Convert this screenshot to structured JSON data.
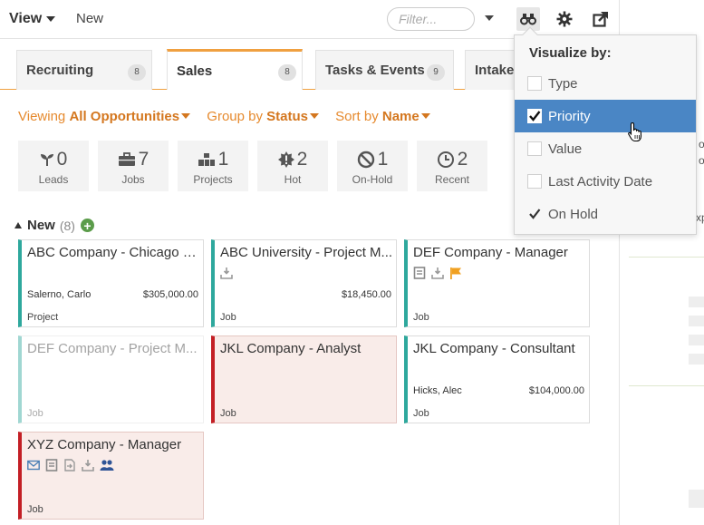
{
  "toolbar": {
    "view_label": "View",
    "new_label": "New",
    "filter_placeholder": "Filter..."
  },
  "tabs": [
    {
      "label": "Recruiting",
      "count": "8",
      "active": false
    },
    {
      "label": "Sales",
      "count": "8",
      "active": true
    },
    {
      "label": "Tasks & Events",
      "count": "9",
      "active": false
    },
    {
      "label": "Intake",
      "count": "",
      "active": false
    }
  ],
  "view_options": {
    "viewing_label": "Viewing",
    "viewing_value": "All Opportunities",
    "group_label": "Group by",
    "group_value": "Status",
    "sort_label": "Sort by",
    "sort_value": "Name"
  },
  "stats": [
    {
      "icon": "sprout-icon",
      "value": "0",
      "label": "Leads"
    },
    {
      "icon": "briefcase-icon",
      "value": "7",
      "label": "Jobs"
    },
    {
      "icon": "stacked-boxes-icon",
      "value": "1",
      "label": "Projects"
    },
    {
      "icon": "hot-badge-icon",
      "value": "2",
      "label": "Hot"
    },
    {
      "icon": "prohibited-icon",
      "value": "1",
      "label": "On-Hold"
    },
    {
      "icon": "clock-icon",
      "value": "2",
      "label": "Recent"
    }
  ],
  "section": {
    "title": "New",
    "count": "(8)"
  },
  "cards": [
    {
      "title": "ABC Company - Chicago E...",
      "person": "Salerno, Carlo",
      "amount": "$305,000.00",
      "type": "Project",
      "icons": [],
      "priority": false,
      "faded": false
    },
    {
      "title": "ABC University - Project M...",
      "person": "",
      "amount": "$18,450.00",
      "type": "Job",
      "icons": [
        "inbox-icon"
      ],
      "priority": false,
      "faded": false
    },
    {
      "title": "DEF Company - Manager",
      "person": "",
      "amount": "",
      "type": "Job",
      "icons": [
        "note-icon",
        "inbox-icon",
        "flag-icon"
      ],
      "priority": false,
      "faded": false
    },
    {
      "title": "DEF Company - Project M...",
      "person": "",
      "amount": "",
      "type": "Job",
      "icons": [],
      "priority": false,
      "faded": true
    },
    {
      "title": "JKL Company - Analyst",
      "person": "",
      "amount": "",
      "type": "Job",
      "icons": [],
      "priority": true,
      "faded": false
    },
    {
      "title": "JKL Company - Consultant",
      "person": "Hicks, Alec",
      "amount": "$104,000.00",
      "type": "Job",
      "icons": [],
      "priority": false,
      "faded": false
    },
    {
      "title": "XYZ Company - Manager",
      "person": "",
      "amount": "",
      "type": "Job",
      "icons": [
        "envelope-icon",
        "note-icon",
        "document-arrow-icon",
        "inbox-icon",
        "people-icon"
      ],
      "priority": true,
      "faded": false
    }
  ],
  "visualize_menu": {
    "header": "Visualize by:",
    "options": [
      {
        "label": "Type",
        "checked": false,
        "selected": false
      },
      {
        "label": "Priority",
        "checked": true,
        "selected": true
      },
      {
        "label": "Value",
        "checked": false,
        "selected": false
      },
      {
        "label": "Last Activity Date",
        "checked": false,
        "selected": false
      },
      {
        "label": "On Hold",
        "checked": true,
        "selected": false
      }
    ]
  },
  "right_pane": {
    "snippets": [
      "xp",
      "o",
      "o"
    ]
  },
  "colors": {
    "accent_orange": "#f0a040",
    "link_orange": "#d4771f",
    "card_stripe_teal": "#2ea89d",
    "priority_red": "#c31f25",
    "menu_highlight": "#4a86c5"
  }
}
